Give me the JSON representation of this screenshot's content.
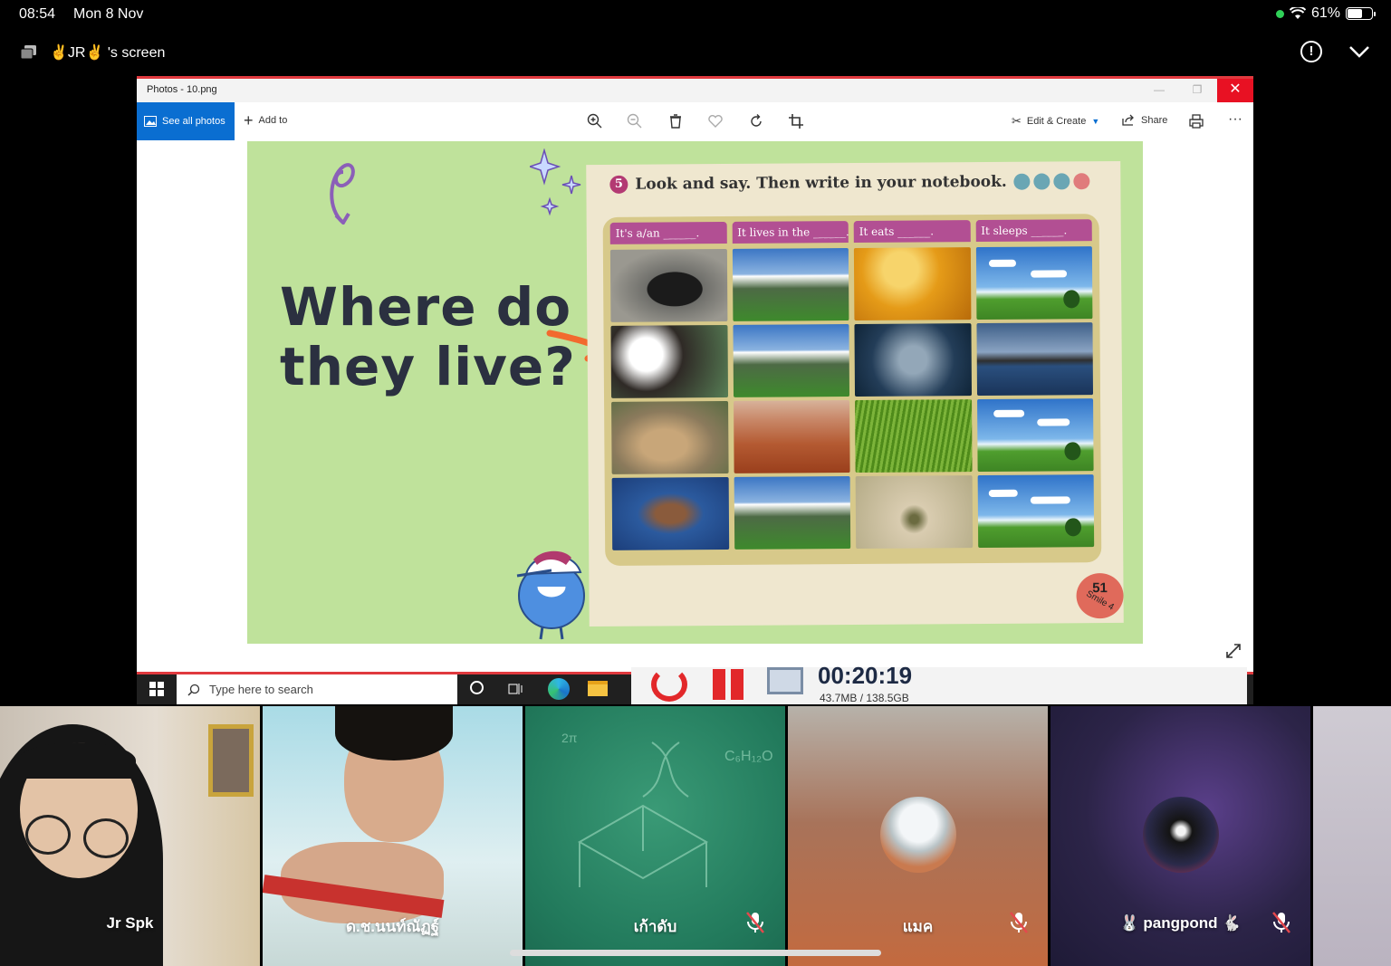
{
  "status_bar": {
    "time": "08:54",
    "date": "Mon 8 Nov",
    "battery": "61%",
    "battery_level": 0.61
  },
  "share_header": {
    "title": "✌JR✌ 's screen"
  },
  "window": {
    "title": "Photos - 10.png",
    "toolbar": {
      "see_all_photos": "See all photos",
      "add_to": "Add to",
      "edit_create": "Edit & Create",
      "share": "Share"
    }
  },
  "slide": {
    "title_line1": "Where do",
    "title_line2": "they live?",
    "instruction": "Look and say. Then write in your notebook.",
    "exercise_number": "5",
    "column_headers": [
      "It's a/an ______.",
      "It lives in the ______.",
      "It eats ______.",
      "It sleeps ______."
    ],
    "page_number": "51",
    "page_brand": "Smile 4"
  },
  "taskbar": {
    "search_placeholder": "Type here to search",
    "recording_time": "00:20:19",
    "recording_size": "43.7MB / 138.5GB"
  },
  "participants": [
    {
      "name": "Jr Spk",
      "muted": false
    },
    {
      "name": "ด.ช.นนท์ณัฏฐ์",
      "muted": false
    },
    {
      "name": "เก้าดับ",
      "muted": true
    },
    {
      "name": "แมค",
      "muted": true
    },
    {
      "name": "🐰 pangpond 🐇",
      "muted": true
    }
  ]
}
